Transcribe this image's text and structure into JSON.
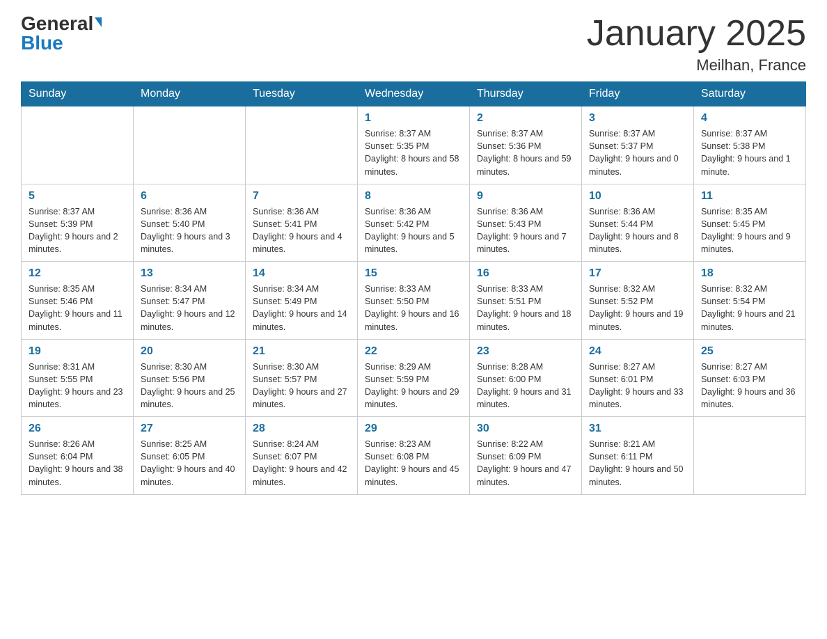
{
  "header": {
    "logo_general": "General",
    "logo_blue": "Blue",
    "title": "January 2025",
    "subtitle": "Meilhan, France"
  },
  "days_of_week": [
    "Sunday",
    "Monday",
    "Tuesday",
    "Wednesday",
    "Thursday",
    "Friday",
    "Saturday"
  ],
  "weeks": [
    [
      {
        "day": "",
        "info": ""
      },
      {
        "day": "",
        "info": ""
      },
      {
        "day": "",
        "info": ""
      },
      {
        "day": "1",
        "info": "Sunrise: 8:37 AM\nSunset: 5:35 PM\nDaylight: 8 hours\nand 58 minutes."
      },
      {
        "day": "2",
        "info": "Sunrise: 8:37 AM\nSunset: 5:36 PM\nDaylight: 8 hours\nand 59 minutes."
      },
      {
        "day": "3",
        "info": "Sunrise: 8:37 AM\nSunset: 5:37 PM\nDaylight: 9 hours\nand 0 minutes."
      },
      {
        "day": "4",
        "info": "Sunrise: 8:37 AM\nSunset: 5:38 PM\nDaylight: 9 hours\nand 1 minute."
      }
    ],
    [
      {
        "day": "5",
        "info": "Sunrise: 8:37 AM\nSunset: 5:39 PM\nDaylight: 9 hours\nand 2 minutes."
      },
      {
        "day": "6",
        "info": "Sunrise: 8:36 AM\nSunset: 5:40 PM\nDaylight: 9 hours\nand 3 minutes."
      },
      {
        "day": "7",
        "info": "Sunrise: 8:36 AM\nSunset: 5:41 PM\nDaylight: 9 hours\nand 4 minutes."
      },
      {
        "day": "8",
        "info": "Sunrise: 8:36 AM\nSunset: 5:42 PM\nDaylight: 9 hours\nand 5 minutes."
      },
      {
        "day": "9",
        "info": "Sunrise: 8:36 AM\nSunset: 5:43 PM\nDaylight: 9 hours\nand 7 minutes."
      },
      {
        "day": "10",
        "info": "Sunrise: 8:36 AM\nSunset: 5:44 PM\nDaylight: 9 hours\nand 8 minutes."
      },
      {
        "day": "11",
        "info": "Sunrise: 8:35 AM\nSunset: 5:45 PM\nDaylight: 9 hours\nand 9 minutes."
      }
    ],
    [
      {
        "day": "12",
        "info": "Sunrise: 8:35 AM\nSunset: 5:46 PM\nDaylight: 9 hours\nand 11 minutes."
      },
      {
        "day": "13",
        "info": "Sunrise: 8:34 AM\nSunset: 5:47 PM\nDaylight: 9 hours\nand 12 minutes."
      },
      {
        "day": "14",
        "info": "Sunrise: 8:34 AM\nSunset: 5:49 PM\nDaylight: 9 hours\nand 14 minutes."
      },
      {
        "day": "15",
        "info": "Sunrise: 8:33 AM\nSunset: 5:50 PM\nDaylight: 9 hours\nand 16 minutes."
      },
      {
        "day": "16",
        "info": "Sunrise: 8:33 AM\nSunset: 5:51 PM\nDaylight: 9 hours\nand 18 minutes."
      },
      {
        "day": "17",
        "info": "Sunrise: 8:32 AM\nSunset: 5:52 PM\nDaylight: 9 hours\nand 19 minutes."
      },
      {
        "day": "18",
        "info": "Sunrise: 8:32 AM\nSunset: 5:54 PM\nDaylight: 9 hours\nand 21 minutes."
      }
    ],
    [
      {
        "day": "19",
        "info": "Sunrise: 8:31 AM\nSunset: 5:55 PM\nDaylight: 9 hours\nand 23 minutes."
      },
      {
        "day": "20",
        "info": "Sunrise: 8:30 AM\nSunset: 5:56 PM\nDaylight: 9 hours\nand 25 minutes."
      },
      {
        "day": "21",
        "info": "Sunrise: 8:30 AM\nSunset: 5:57 PM\nDaylight: 9 hours\nand 27 minutes."
      },
      {
        "day": "22",
        "info": "Sunrise: 8:29 AM\nSunset: 5:59 PM\nDaylight: 9 hours\nand 29 minutes."
      },
      {
        "day": "23",
        "info": "Sunrise: 8:28 AM\nSunset: 6:00 PM\nDaylight: 9 hours\nand 31 minutes."
      },
      {
        "day": "24",
        "info": "Sunrise: 8:27 AM\nSunset: 6:01 PM\nDaylight: 9 hours\nand 33 minutes."
      },
      {
        "day": "25",
        "info": "Sunrise: 8:27 AM\nSunset: 6:03 PM\nDaylight: 9 hours\nand 36 minutes."
      }
    ],
    [
      {
        "day": "26",
        "info": "Sunrise: 8:26 AM\nSunset: 6:04 PM\nDaylight: 9 hours\nand 38 minutes."
      },
      {
        "day": "27",
        "info": "Sunrise: 8:25 AM\nSunset: 6:05 PM\nDaylight: 9 hours\nand 40 minutes."
      },
      {
        "day": "28",
        "info": "Sunrise: 8:24 AM\nSunset: 6:07 PM\nDaylight: 9 hours\nand 42 minutes."
      },
      {
        "day": "29",
        "info": "Sunrise: 8:23 AM\nSunset: 6:08 PM\nDaylight: 9 hours\nand 45 minutes."
      },
      {
        "day": "30",
        "info": "Sunrise: 8:22 AM\nSunset: 6:09 PM\nDaylight: 9 hours\nand 47 minutes."
      },
      {
        "day": "31",
        "info": "Sunrise: 8:21 AM\nSunset: 6:11 PM\nDaylight: 9 hours\nand 50 minutes."
      },
      {
        "day": "",
        "info": ""
      }
    ]
  ]
}
